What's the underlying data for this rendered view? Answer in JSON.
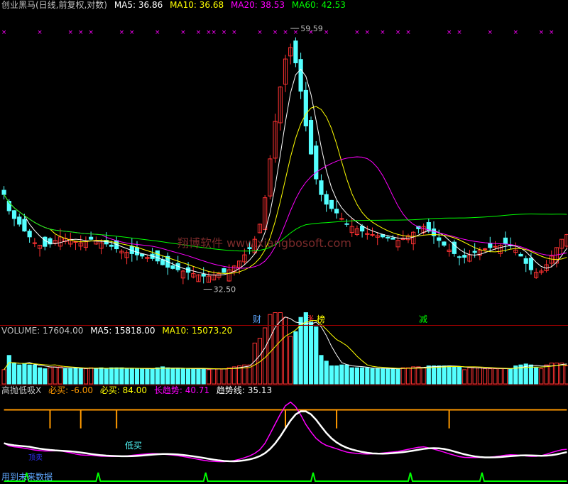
{
  "header": {
    "title": "创业黑马(日线,前复权,对数)",
    "ma5": "MA5: 36.86",
    "ma10": "MA10: 36.68",
    "ma20": "MA20: 38.53",
    "ma60": "MA60: 42.53"
  },
  "volume_header": {
    "volume": "VOLUME: 17604.00",
    "ma5": "MA5: 15818.00",
    "ma10": "MA10: 15073.20"
  },
  "indicator_header": {
    "name": "高抛低吸X",
    "bimai_neg": "必买: -6.00",
    "bimai": "必买: 84.00",
    "long_trend": "长趋势: 40.71",
    "trend_line": "趋势线: 35.13"
  },
  "watermark": "翔博软件 www.xiangbosoft.com",
  "annotations": {
    "high": "59.59",
    "low": "32.50",
    "badge_cai": "财",
    "badge_zhang": "涨",
    "badge_bang": "榜",
    "badge_jian": "减",
    "low_buy": "低买",
    "top_sell": "顶卖",
    "bottom_text": "用到未来数据"
  },
  "colors": {
    "background": "#000000",
    "up": "#ff3232",
    "down": "#54ffff",
    "ma5": "#ffffff",
    "ma10": "#ffff00",
    "ma20": "#ff00ff",
    "ma60": "#00ff00",
    "separator": "#a00000",
    "signal_orange": "#ff9900",
    "marker_magenta": "#ff00ff"
  },
  "chart_data": {
    "type": "candlestick",
    "price_range": [
      30,
      62
    ],
    "high": 59.59,
    "low": 32.5,
    "closes": [
      40.5,
      39,
      38.3,
      37.8,
      37.2,
      36.7,
      36.2,
      36,
      35.9,
      36.1,
      36.4,
      36.7,
      36.6,
      36.5,
      36.3,
      36.2,
      36.3,
      36.5,
      36.4,
      36.2,
      36.1,
      35.9,
      35.7,
      35.5,
      35.4,
      35.3,
      35.2,
      35.1,
      35.0,
      34.9,
      34.7,
      34.4,
      34.2,
      34.1,
      34.0,
      33.9,
      33.8,
      33.7,
      33.6,
      33.5,
      33.5,
      33.6,
      33.7,
      33.8,
      34.0,
      34.3,
      34.7,
      35.2,
      35.7,
      36.5,
      37.8,
      40.2,
      44.0,
      48.0,
      52.0,
      55.5,
      57.0,
      55.0,
      51.5,
      47.5,
      44.5,
      42.0,
      40.5,
      39.6,
      39.2,
      38.8,
      38.3,
      37.8,
      37.6,
      37.4,
      37.2,
      37.0,
      36.9,
      36.8,
      36.7,
      36.6,
      36.5,
      36.4,
      36.6,
      36.8,
      37.1,
      37.4,
      37.6,
      37.2,
      36.8,
      36.4,
      36.0,
      35.6,
      35.3,
      35.0,
      35.0,
      35.2,
      35.4,
      35.6,
      35.7,
      35.8,
      35.9,
      36.0,
      36.1,
      36.0,
      35.6,
      35.1,
      34.5,
      34.0,
      33.8,
      33.9,
      34.4,
      35.1,
      35.8,
      36.5,
      36.9
    ],
    "moving_averages": [
      "MA5",
      "MA10",
      "MA20",
      "MA60"
    ],
    "volume_range": [
      0,
      30000
    ],
    "indicator_series": [
      "必买",
      "长趋势",
      "趋势线"
    ]
  }
}
